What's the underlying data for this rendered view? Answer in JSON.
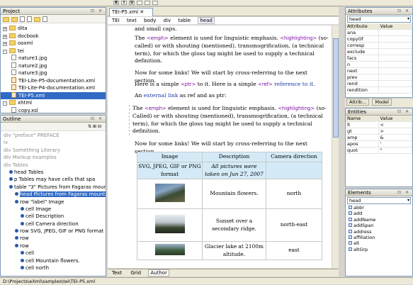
{
  "toolbar": {
    "buttons": [
      "B",
      "I",
      "U",
      "",
      "",
      ""
    ]
  },
  "project": {
    "title": "Project",
    "items": [
      {
        "label": "dita",
        "type": "folder",
        "level": 0,
        "expand": "+"
      },
      {
        "label": "docbook",
        "type": "folder",
        "level": 0,
        "expand": "+"
      },
      {
        "label": "ooxml",
        "type": "folder",
        "level": 0,
        "expand": "+"
      },
      {
        "label": "tei",
        "type": "folder",
        "level": 0,
        "expand": "-"
      },
      {
        "label": "nature1.jpg",
        "type": "file",
        "level": 1
      },
      {
        "label": "nature2.jpg",
        "type": "file",
        "level": 1
      },
      {
        "label": "nature3.jpg",
        "type": "file",
        "level": 1
      },
      {
        "label": "TEI-Lite-P5-documentation.xml",
        "type": "xml",
        "level": 1
      },
      {
        "label": "TEI-Lite-P4-documentation.xml",
        "type": "xml",
        "level": 1
      },
      {
        "label": "TEI-P5.xml",
        "type": "xml",
        "level": 1,
        "selected": true
      },
      {
        "label": "xhtml",
        "type": "folder",
        "level": 0,
        "expand": "-"
      },
      {
        "label": "copy.xsl",
        "type": "file",
        "level": 1
      }
    ]
  },
  "outline": {
    "title": "Outline",
    "items": [
      {
        "text": "div \"preface\" PREFACE",
        "indent": 0,
        "grey": true
      },
      {
        "text": "iv",
        "indent": 0,
        "grey": true
      },
      {
        "text": "div  Something Literary",
        "indent": 0,
        "grey": true
      },
      {
        "text": "div  Markup examples",
        "indent": 0,
        "grey": true
      },
      {
        "text": "div  Tables",
        "indent": 0,
        "grey": true
      },
      {
        "text": "head  Tables",
        "indent": 1
      },
      {
        "text": "p  Tables may have cells that spa",
        "indent": 1
      },
      {
        "text": "table  \"3\" Pictures from Fagaras mountain",
        "indent": 1
      },
      {
        "text": "head  Pictures from Fagaras mountain",
        "indent": 2,
        "selected": true
      },
      {
        "text": "row  \"label\" Image",
        "indent": 2
      },
      {
        "text": "cell  Image",
        "indent": 3
      },
      {
        "text": "cell  Description",
        "indent": 3
      },
      {
        "text": "cell  Camera direction",
        "indent": 3
      },
      {
        "text": "row  SVG, JPEG, GIF or PNG format",
        "indent": 2
      },
      {
        "text": "row",
        "indent": 2
      },
      {
        "text": "row",
        "indent": 2
      },
      {
        "text": "cell",
        "indent": 3
      },
      {
        "text": "cell  Mountain flowers.",
        "indent": 3
      },
      {
        "text": "cell  north",
        "indent": 3
      }
    ]
  },
  "editor": {
    "tab": "TEI-P5.xml",
    "breadcrumb": [
      "TEI",
      "text",
      "body",
      "div",
      "table",
      "head"
    ],
    "lines": {
      "l1": "and small caps.",
      "p1a": "The",
      "p1tag1": "emph",
      "p1b": "element is used for linguistic emphasis.",
      "p1tag2": "highlighting",
      "p1c": "(so-called) or with shouting (mentioned), transmogrification, (a technical term), for which the gloss tag might be used to supply a technical definition.",
      "p2": "Now for some links! We will start by cross-referring to the next section.",
      "p3a": "Here is a simple",
      "p3tag": "ptr",
      "p3b": "to it. Here is a simple",
      "p3tag2": "ref",
      "p3c": "reference to it.",
      "p4a": "An",
      "p4b": "external link",
      "p4c": "as ref and as ptr:",
      "p5a": "The",
      "p5tag1": "emph",
      "p5b": "element is used for linguistic emphasis.",
      "p5tag2": "highlighting",
      "p5c": "(so-Called) or with shouting (mentioned), transmogrification, (a technical term), for which the gloss tag might be used to supply a technical definition.",
      "p6": "Now for some links! We will start by cross-referring to the next section."
    },
    "table": {
      "headers": [
        "Image",
        "Description",
        "Camera direction"
      ],
      "row1": [
        "SVG, JPEG, GIF or PNG format",
        "All pictures were taken on Jun 27, 2007",
        ""
      ],
      "rows": [
        {
          "desc": "Mountain flowers.",
          "dir": "north"
        },
        {
          "desc": "Sunset over a secondary ridge.",
          "dir": "north-east"
        },
        {
          "desc": "Glacier lake at 2100m altitude.",
          "dir": "east"
        }
      ]
    },
    "bottom_tabs": [
      "Text",
      "Grid",
      "Author"
    ]
  },
  "attributes": {
    "title": "Attributes",
    "selected": "head",
    "columns": [
      "Attribute",
      "Value"
    ],
    "items": [
      "ana",
      "copyOf",
      "corresp",
      "exclude",
      "facs",
      "n",
      "next",
      "prev",
      "rend",
      "rendition"
    ]
  },
  "right_tabs": [
    "Attrib...",
    "Model"
  ],
  "entities": {
    "title": "Entities",
    "columns": [
      "Name",
      "Value"
    ],
    "items": [
      {
        "name": "lt",
        "value": "<"
      },
      {
        "name": "gt",
        "value": ">"
      },
      {
        "name": "amp",
        "value": "&"
      },
      {
        "name": "apos",
        "value": "'"
      },
      {
        "name": "quot",
        "value": "\""
      }
    ]
  },
  "elements": {
    "title": "Elements",
    "selected": "head",
    "items": [
      "abbr",
      "add",
      "addName",
      "addSpan",
      "address",
      "affiliation",
      "alt",
      "altGrp"
    ]
  },
  "status": "D:\\Projects\\eXml\\samples\\tei\\TEI-P5.xml"
}
